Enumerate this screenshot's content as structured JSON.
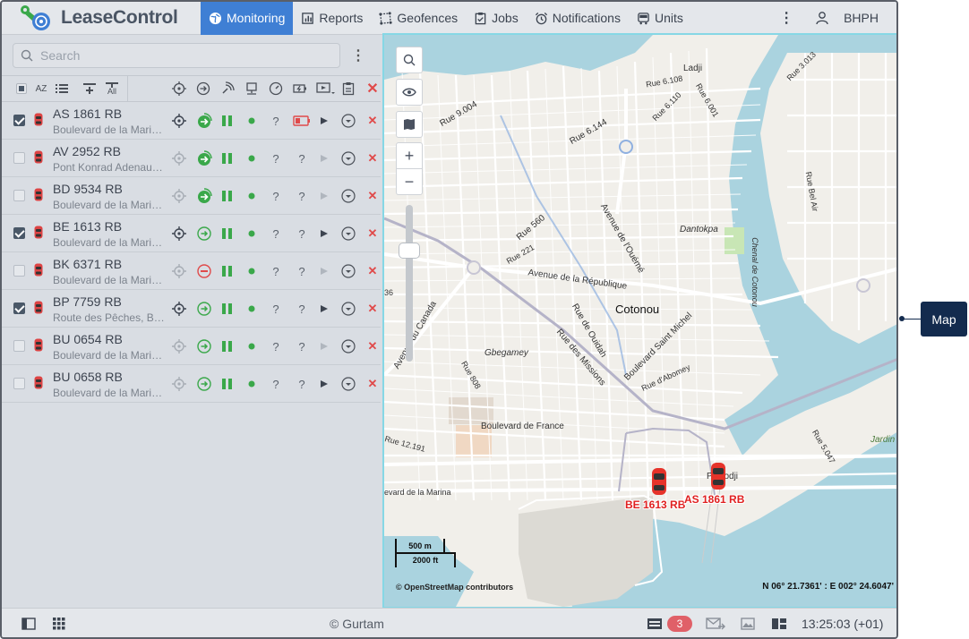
{
  "app": {
    "name": "LeaseControl"
  },
  "nav": [
    {
      "label": "Monitoring",
      "icon": "globe-icon"
    },
    {
      "label": "Reports",
      "icon": "report-icon"
    },
    {
      "label": "Geofences",
      "icon": "geofence-icon"
    },
    {
      "label": "Jobs",
      "icon": "jobs-icon"
    },
    {
      "label": "Notifications",
      "icon": "alarm-icon"
    },
    {
      "label": "Units",
      "icon": "bus-icon"
    }
  ],
  "user": {
    "name": "BHPH"
  },
  "search": {
    "placeholder": "Search"
  },
  "toolbar": {
    "sort_label": "AZ",
    "all_label": "All"
  },
  "units": [
    {
      "name": "AS 1861 RB",
      "address": "Boulevard de la Marina, Cotonou",
      "checked": true,
      "movement": "moving",
      "power_badge": true,
      "play": "dark"
    },
    {
      "name": "AV 2952 RB",
      "address": "Pont Konrad Adenauer, Cotonou",
      "checked": false,
      "movement": "moving",
      "power_badge": false,
      "play": "light"
    },
    {
      "name": "BD 9534 RB",
      "address": "Boulevard de la Marina, Cotonou",
      "checked": false,
      "movement": "moving",
      "power_badge": false,
      "play": "light"
    },
    {
      "name": "BE 1613 RB",
      "address": "Boulevard de la Marina, Cotonou",
      "checked": true,
      "movement": "parked",
      "power_badge": false,
      "play": "dark"
    },
    {
      "name": "BK 6371 RB",
      "address": "Boulevard de la Marina, Cotonou",
      "checked": false,
      "movement": "stopped",
      "power_badge": false,
      "play": "light"
    },
    {
      "name": "BP 7759 RB",
      "address": "Route des Pêches, Benin",
      "checked": true,
      "movement": "parked",
      "power_badge": false,
      "play": "dark"
    },
    {
      "name": "BU 0654 RB",
      "address": "Boulevard de la Marina, Cotonou",
      "checked": false,
      "movement": "parked",
      "power_badge": false,
      "play": "light"
    },
    {
      "name": "BU 0658 RB",
      "address": "Boulevard de la Marina, Cotonou",
      "checked": false,
      "movement": "parked",
      "power_badge": false,
      "play": "dark"
    }
  ],
  "row_symbols": {
    "unknown": "?",
    "delete": "✕"
  },
  "map": {
    "city": "Cotonou",
    "streets": [
      "Rue 9.004",
      "Rue 6.144",
      "Ladji",
      "Rue 6.108",
      "Rue 6.110",
      "Rue 6.001",
      "Rue 3.013",
      "Rue Bel Air",
      "Rue 560",
      "Rue 221",
      "Avenue de l'Ouémé",
      "Dantokpa",
      "Avenue de la République",
      "Avenue du Canada",
      "Rue de Ouidah",
      "Boulevard Saint Michel",
      "Rue des Missions",
      "Gbegamey",
      "Rue d'Abomey",
      "Rue 808",
      "Chenal de Cotonou",
      "Boulevard de France",
      "Rue 12.191",
      "Rue 5.047",
      "Jardin",
      "Placodji",
      "evard de la Marina",
      "36"
    ],
    "markers": [
      {
        "label": "BE 1613 RB"
      },
      {
        "label": "AS 1861 RB"
      }
    ],
    "scale_metric": "500 m",
    "scale_imperial": "2000 ft",
    "attribution": "© OpenStreetMap contributors",
    "coordinates": "N 06° 21.7361' : E 002° 24.6047'"
  },
  "callout": {
    "label": "Map"
  },
  "footer": {
    "copyright": "© Gurtam",
    "notifications_count": "3",
    "time": "13:25:03 (+01)"
  },
  "colors": {
    "accent": "#3f7fd4",
    "water": "#aad3df",
    "danger": "#e04a4a",
    "moving": "#3aa84a"
  }
}
